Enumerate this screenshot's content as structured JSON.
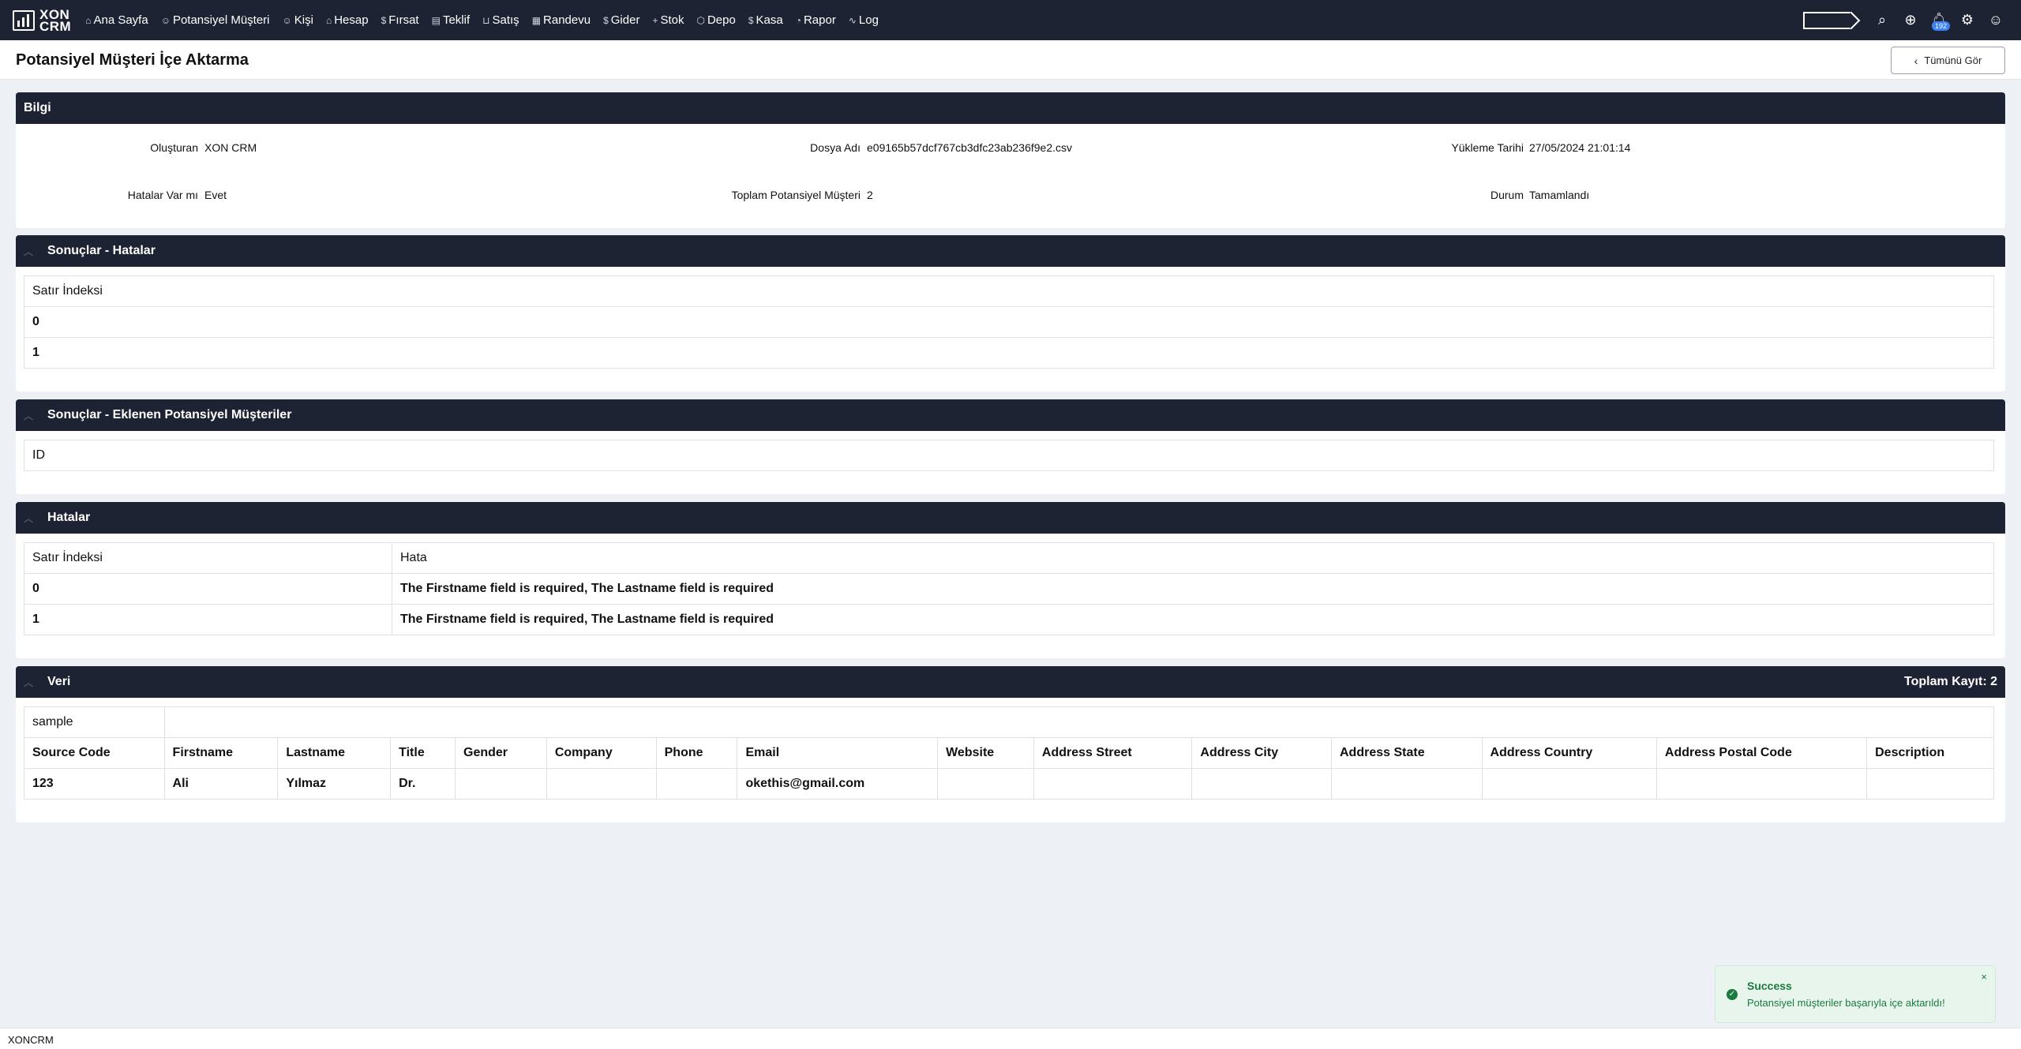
{
  "app": {
    "logo_line1": "XON",
    "logo_line2": "CRM"
  },
  "nav": [
    {
      "icon": "home-icon",
      "glyph": "⌂",
      "label": "Ana Sayfa"
    },
    {
      "icon": "person-icon",
      "glyph": "☺",
      "label": "Potansiyel Müşteri"
    },
    {
      "icon": "people-icon",
      "glyph": "☺",
      "label": "Kişi"
    },
    {
      "icon": "account-icon",
      "glyph": "⌂",
      "label": "Hesap"
    },
    {
      "icon": "dollar-icon",
      "glyph": "$",
      "label": "Fırsat"
    },
    {
      "icon": "document-icon",
      "glyph": "▤",
      "label": "Teklif"
    },
    {
      "icon": "cart-icon",
      "glyph": "⊔",
      "label": "Satış"
    },
    {
      "icon": "calendar-icon",
      "glyph": "▦",
      "label": "Randevu"
    },
    {
      "icon": "dollar-icon",
      "glyph": "$",
      "label": "Gider"
    },
    {
      "icon": "plus-icon",
      "glyph": "+",
      "label": "Stok"
    },
    {
      "icon": "box-icon",
      "glyph": "⬡",
      "label": "Depo"
    },
    {
      "icon": "dollar-icon",
      "glyph": "$",
      "label": "Kasa"
    },
    {
      "icon": "chart-icon",
      "glyph": "◔",
      "label": "Rapor"
    },
    {
      "icon": "activity-icon",
      "glyph": "∿",
      "label": "Log"
    }
  ],
  "toolbar": {
    "notification_count": "192"
  },
  "page": {
    "title": "Potansiyel Müşteri İçe Aktarma",
    "back_label": "Tümünü Gör"
  },
  "info": {
    "title": "Bilgi",
    "created_by_label": "Oluşturan",
    "created_by": "XON CRM",
    "file_label": "Dosya Adı",
    "file": "e09165b57dcf767cb3dfc23ab236f9e2.csv",
    "upload_label": "Yükleme Tarihi",
    "upload": "27/05/2024 21:01:14",
    "errors_label": "Hatalar Var mı",
    "errors": "Evet",
    "total_label": "Toplam Potansiyel Müşteri",
    "total": "2",
    "status_label": "Durum",
    "status": "Tamamlandı"
  },
  "results_errors": {
    "title": "Sonuçlar - Hatalar",
    "header": "Satır İndeksi",
    "rows": [
      "0",
      "1"
    ]
  },
  "results_added": {
    "title": "Sonuçlar - Eklenen Potansiyel Müşteriler",
    "header": "ID"
  },
  "errors": {
    "title": "Hatalar",
    "headers": [
      "Satır İndeksi",
      "Hata"
    ],
    "rows": [
      [
        "0",
        "The Firstname field is required, The Lastname field is required"
      ],
      [
        "1",
        "The Firstname field is required, The Lastname field is required"
      ]
    ]
  },
  "data": {
    "title": "Veri",
    "total": "Toplam Kayıt: 2",
    "group": "sample",
    "headers": [
      "Source Code",
      "Firstname",
      "Lastname",
      "Title",
      "Gender",
      "Company",
      "Phone",
      "Email",
      "Website",
      "Address Street",
      "Address City",
      "Address State",
      "Address Country",
      "Address Postal Code",
      "Description"
    ],
    "rows": [
      [
        "123",
        "Ali",
        "Yılmaz",
        "Dr.",
        "",
        "",
        "",
        "okethis@gmail.com",
        "",
        "",
        "",
        "",
        "",
        "",
        ""
      ]
    ]
  },
  "toast": {
    "title": "Success",
    "message": "Potansiyel müşteriler başarıyla içe aktarıldı!",
    "close": "×"
  },
  "footer": {
    "text": "XONCRM"
  }
}
